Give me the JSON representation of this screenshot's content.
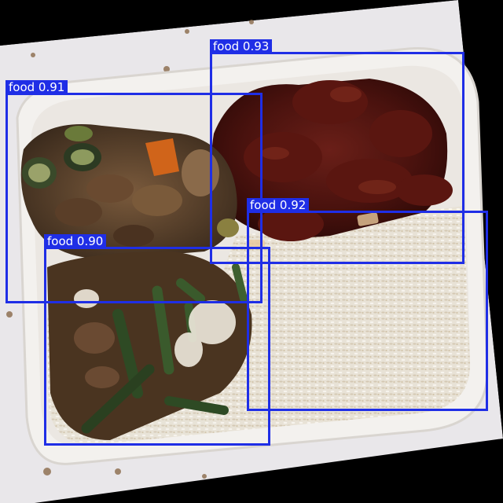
{
  "image": {
    "subject": "takeout-container-with-stir-fry-and-rice",
    "background_color": "#000000",
    "container_color": "#f2f0ee"
  },
  "detections": [
    {
      "label": "food 0.93",
      "class": "food",
      "confidence": 0.93
    },
    {
      "label": "food 0.91",
      "class": "food",
      "confidence": 0.91
    },
    {
      "label": "food 0.92",
      "class": "food",
      "confidence": 0.92
    },
    {
      "label": "food 0.90",
      "class": "food",
      "confidence": 0.9
    }
  ],
  "colors": {
    "box": "#1f2ee6",
    "label_text": "#ffffff"
  }
}
